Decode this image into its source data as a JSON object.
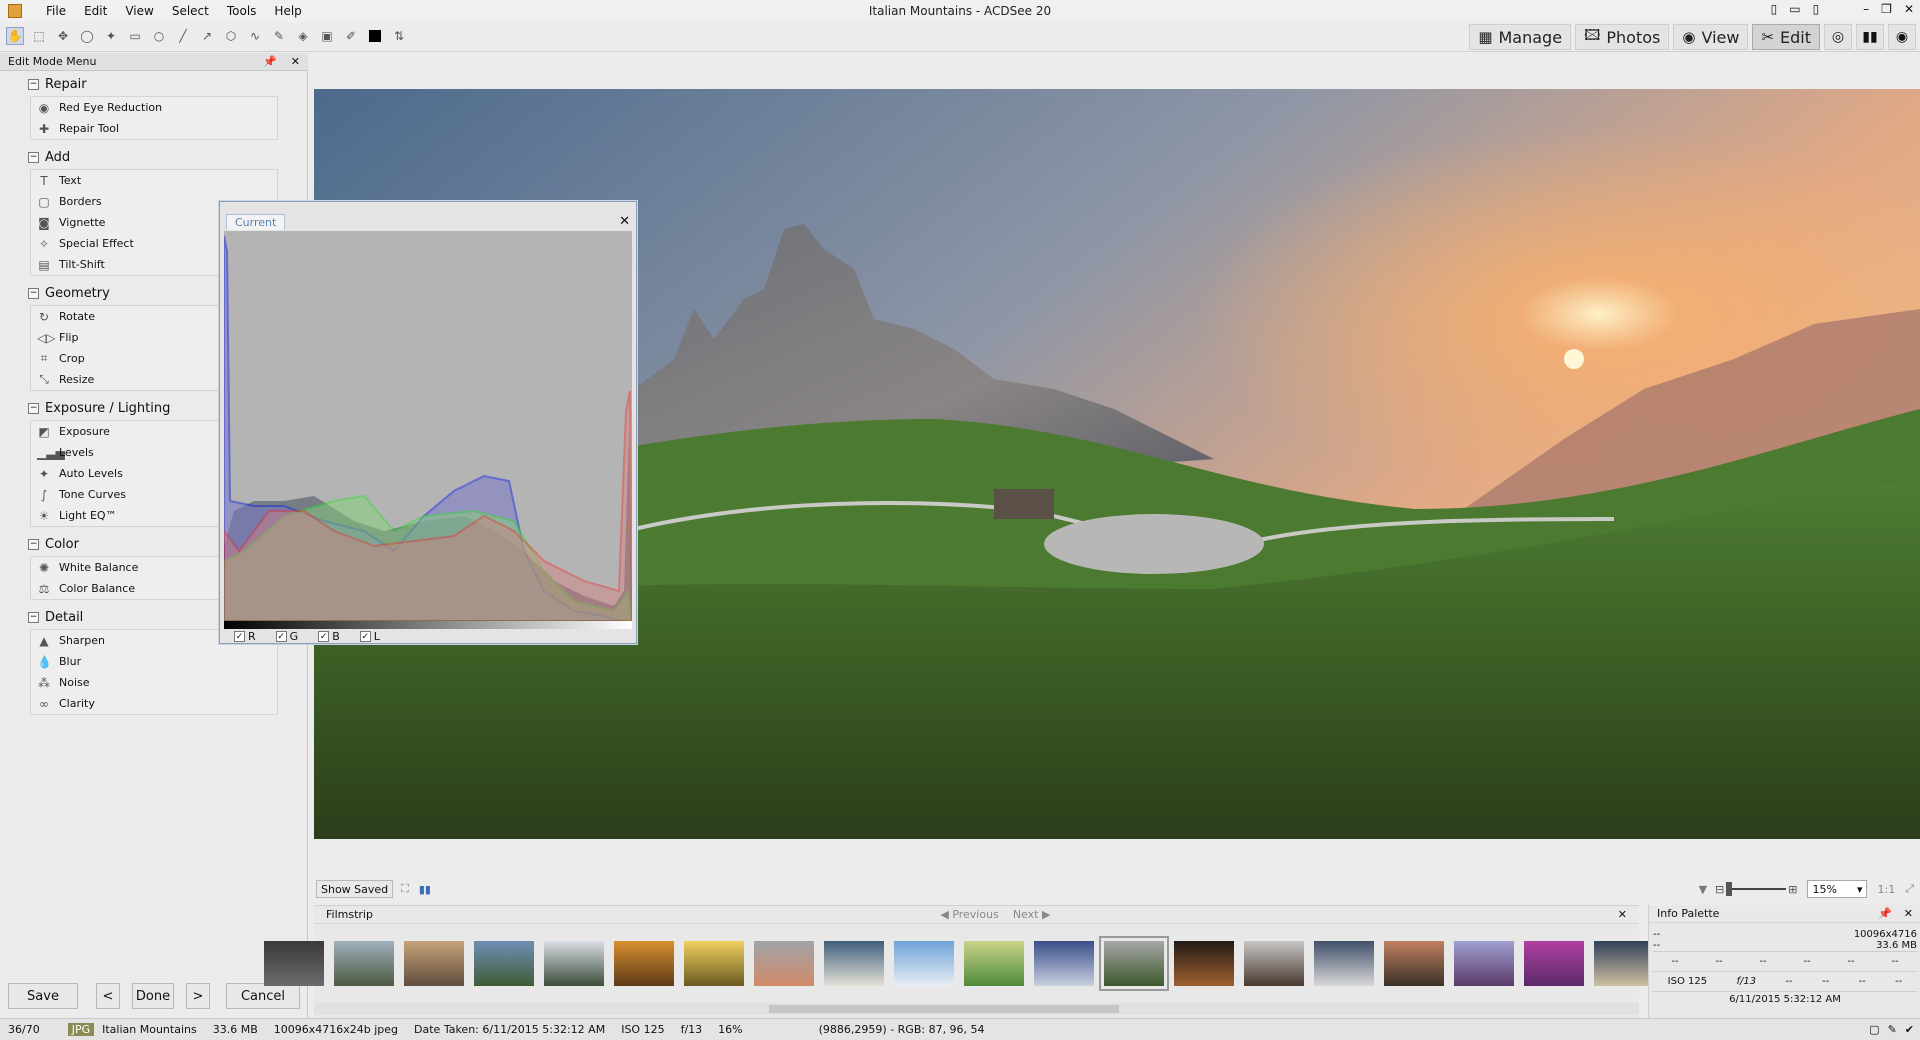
{
  "window": {
    "title": "Italian Mountains - ACDSee 20"
  },
  "menu": [
    "File",
    "Edit",
    "View",
    "Select",
    "Tools",
    "Help"
  ],
  "modes": [
    {
      "label": "Manage",
      "icon": "grid-icon"
    },
    {
      "label": "Photos",
      "icon": "photos-icon"
    },
    {
      "label": "View",
      "icon": "eye-icon"
    },
    {
      "label": "Edit",
      "icon": "edit-icon",
      "active": true
    }
  ],
  "left_panel": {
    "title": "Edit Mode Menu",
    "groups": [
      {
        "name": "Repair",
        "items": [
          "Red Eye Reduction",
          "Repair Tool"
        ]
      },
      {
        "name": "Add",
        "items": [
          "Text",
          "Borders",
          "Vignette",
          "Special Effect",
          "Tilt-Shift"
        ]
      },
      {
        "name": "Geometry",
        "items": [
          "Rotate",
          "Flip",
          "Crop",
          "Resize"
        ]
      },
      {
        "name": "Exposure / Lighting",
        "items": [
          "Exposure",
          "Levels",
          "Auto Levels",
          "Tone Curves",
          "Light EQ™"
        ]
      },
      {
        "name": "Color",
        "items": [
          "White Balance",
          "Color Balance"
        ]
      },
      {
        "name": "Detail",
        "items": [
          "Sharpen",
          "Blur",
          "Noise",
          "Clarity"
        ]
      }
    ],
    "buttons": {
      "save": "Save",
      "done": "Done",
      "cancel": "Cancel",
      "prev": "<",
      "next": ">"
    }
  },
  "histogram": {
    "tab": "Current",
    "channels": [
      "R",
      "G",
      "B",
      "L"
    ]
  },
  "image_bar": {
    "show_saved": "Show Saved",
    "zoom": "15%",
    "ratio": "1:1"
  },
  "filmstrip": {
    "title": "Filmstrip",
    "previous": "Previous",
    "next": "Next"
  },
  "info_palette": {
    "title": "Info Palette",
    "dims": "10096x4716",
    "size": "33.6 MB",
    "dash": "--",
    "iso": "ISO 125",
    "fstop": "f/13",
    "date": "6/11/2015 5:32:12 AM"
  },
  "status": {
    "index": "36/70",
    "format": "JPG",
    "name": "Italian Mountains",
    "size": "33.6 MB",
    "dims": "10096x4716x24b jpeg",
    "date": "Date Taken: 6/11/2015 5:32:12 AM",
    "iso": "ISO 125",
    "fstop": "f/13",
    "zoom": "16%",
    "pixel": "(9886,2959) - RGB: 87, 96, 54"
  },
  "colors": {
    "accent": "#5b7fb3",
    "sky_top": "#4f6d8e",
    "sky_glow": "#f3a86a",
    "grass": "#3f6a2a"
  }
}
